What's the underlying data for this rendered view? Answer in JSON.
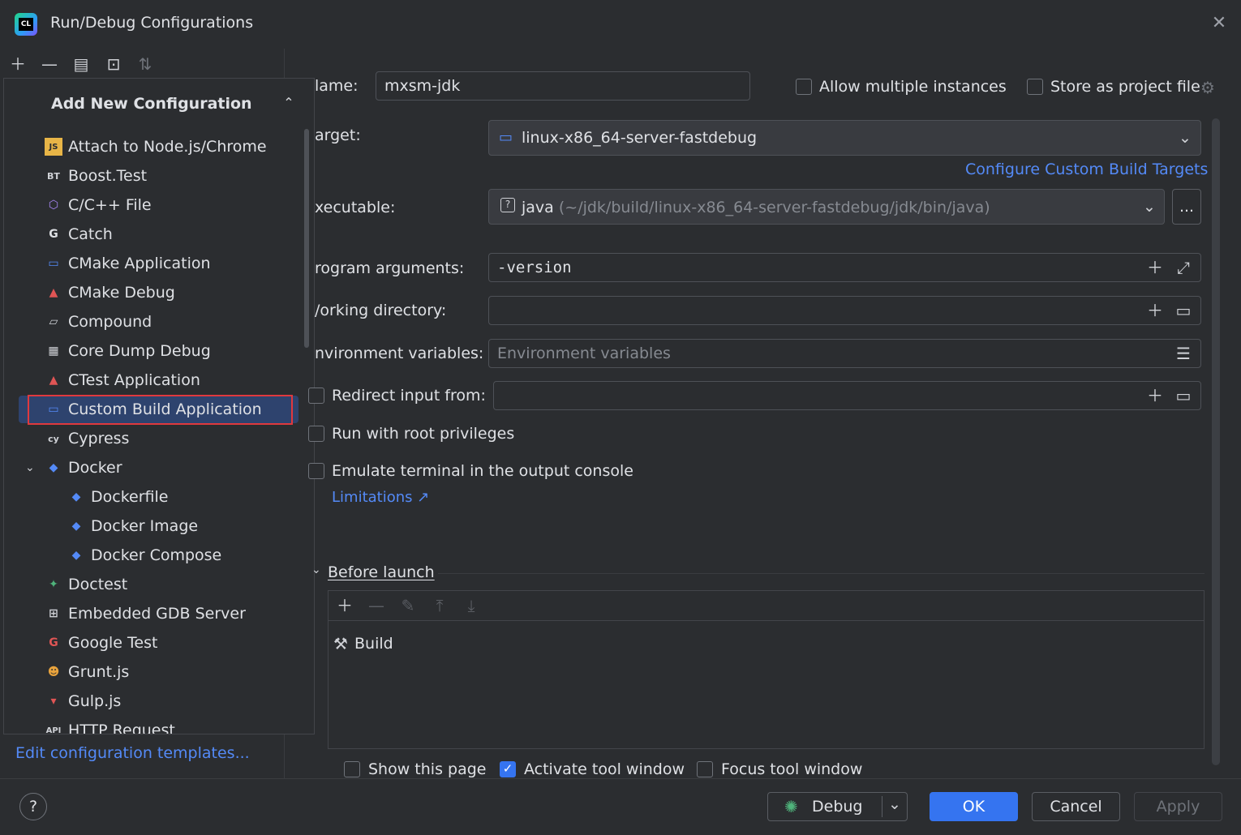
{
  "window": {
    "title": "Run/Debug Configurations",
    "app_icon": "clion-logo"
  },
  "toolbar": {
    "icons": [
      "add-icon",
      "remove-icon",
      "copy-icon",
      "new-folder-icon",
      "sort-icon"
    ]
  },
  "popup": {
    "title": "Add New Configuration",
    "items": [
      {
        "label": "Attach to Node.js/Chrome",
        "icon": "nodejs-icon"
      },
      {
        "label": "Boost.Test",
        "icon": "boost-test-icon"
      },
      {
        "label": "C/C++ File",
        "icon": "cpp-file-icon"
      },
      {
        "label": "Catch",
        "icon": "catch-icon"
      },
      {
        "label": "CMake Application",
        "icon": "cmake-app-icon"
      },
      {
        "label": "CMake Debug",
        "icon": "cmake-debug-icon"
      },
      {
        "label": "Compound",
        "icon": "compound-icon"
      },
      {
        "label": "Core Dump Debug",
        "icon": "core-dump-icon"
      },
      {
        "label": "CTest Application",
        "icon": "ctest-icon"
      },
      {
        "label": "Custom Build Application",
        "icon": "custom-build-icon"
      },
      {
        "label": "Cypress",
        "icon": "cypress-icon"
      },
      {
        "label": "Docker",
        "icon": "docker-icon"
      },
      {
        "label": "Dockerfile",
        "icon": "docker-icon"
      },
      {
        "label": "Docker Image",
        "icon": "docker-icon"
      },
      {
        "label": "Docker Compose",
        "icon": "docker-icon"
      },
      {
        "label": "Doctest",
        "icon": "doctest-icon"
      },
      {
        "label": "Embedded GDB Server",
        "icon": "gdb-server-icon"
      },
      {
        "label": "Google Test",
        "icon": "google-test-icon"
      },
      {
        "label": "Grunt.js",
        "icon": "grunt-icon"
      },
      {
        "label": "Gulp.js",
        "icon": "gulp-icon"
      },
      {
        "label": "HTTP Request",
        "icon": "http-request-icon"
      }
    ]
  },
  "edit_templates_link": "Edit configuration templates...",
  "form": {
    "name_label": "lame:",
    "name_value": "mxsm-jdk",
    "allow_multiple": "Allow multiple instances",
    "store_as_project": "Store as project file",
    "target_label": "arget:",
    "target_value": "linux-x86_64-server-fastdebug",
    "configure_targets_link": "Configure Custom Build Targets",
    "executable_label": "xecutable:",
    "executable_name": "java",
    "executable_path": "(~/jdk/build/linux-x86_64-server-fastdebug/jdk/bin/java)",
    "browse_button": "...",
    "program_args_label": "rogram arguments:",
    "program_args_value": "-version",
    "working_dir_label": "/orking directory:",
    "env_vars_label": "nvironment variables:",
    "env_vars_placeholder": "Environment variables",
    "redirect_input": "Redirect input from:",
    "run_root": "Run with root privileges",
    "emulate_terminal": "Emulate terminal in the output console",
    "limitations_link": "Limitations ↗",
    "before_launch": "Before launch",
    "before_launch_items": [
      {
        "label": "Build",
        "icon": "build-hammer-icon"
      }
    ],
    "show_page": "Show this page",
    "activate_tool": "Activate tool window",
    "focus_tool": "Focus tool window"
  },
  "buttons": {
    "help": "?",
    "debug": "Debug",
    "ok": "OK",
    "cancel": "Cancel",
    "apply": "Apply"
  },
  "colors": {
    "accent": "#3574f0",
    "link": "#548af7",
    "selection": "#2e436e",
    "highlight_outline": "#e0393e"
  }
}
